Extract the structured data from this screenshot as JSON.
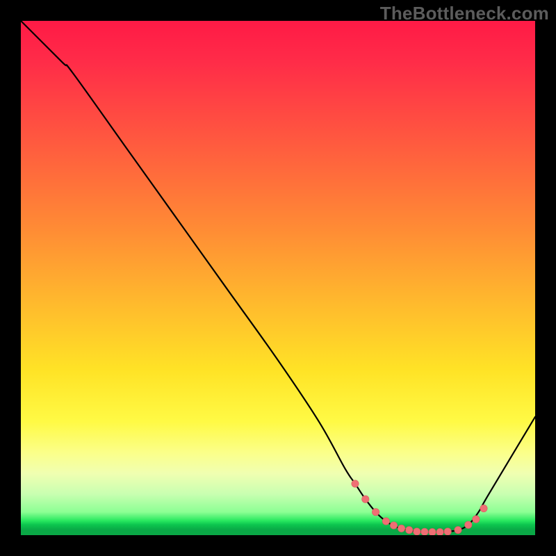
{
  "watermark": "TheBottleneck.com",
  "colors": {
    "frame_bg": "#000000",
    "gradient_top": "#ff1a46",
    "gradient_mid": "#ffe326",
    "gradient_low_yellow": "#fbff8a",
    "gradient_green_band": "#8cff94",
    "gradient_bottom_green": "#0aa846",
    "curve_stroke": "#000000",
    "dot_fill": "#ef6f74"
  },
  "chart_data": {
    "type": "line",
    "title": "",
    "xlabel": "",
    "ylabel": "",
    "xlim": [
      0,
      100
    ],
    "ylim": [
      0,
      100
    ],
    "series": [
      {
        "name": "curve",
        "x": [
          0,
          8,
          10,
          20,
          30,
          40,
          50,
          58,
          63,
          65,
          67,
          69,
          71,
          73,
          75,
          77,
          79,
          81,
          83,
          85,
          87,
          89,
          91,
          100
        ],
        "y": [
          100,
          92,
          90,
          76,
          62,
          48,
          34,
          22,
          13,
          10,
          7,
          4.5,
          2.7,
          1.6,
          1.0,
          0.7,
          0.6,
          0.6,
          0.7,
          1.0,
          2.0,
          4.5,
          8,
          23
        ]
      }
    ],
    "markers": {
      "name": "flat-region-dots",
      "x": [
        65,
        67,
        69,
        71,
        72.5,
        74,
        75.5,
        77,
        78.5,
        80,
        81.5,
        83,
        85,
        87,
        88.5,
        90
      ],
      "y": [
        10,
        7,
        4.5,
        2.7,
        1.9,
        1.3,
        1.0,
        0.7,
        0.65,
        0.6,
        0.6,
        0.7,
        1.0,
        2.0,
        3.1,
        5.2
      ]
    },
    "notes": "Single black curve over a vertical red→yellow→green gradient. Values are approximate; no axis ticks or labels are rendered in the image. The curve descends steeply from top-left, flattens near the bottom around x≈75–85, then rises again toward the right edge. Salmon dots mark the flat valley region."
  }
}
